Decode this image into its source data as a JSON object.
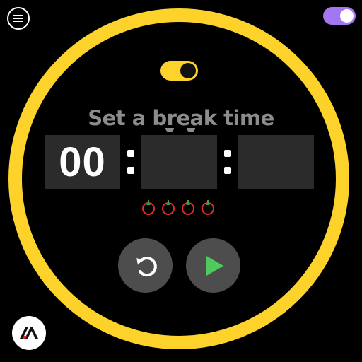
{
  "header": {
    "menu_icon": "hamburger-menu-icon",
    "theme_toggle": {
      "state": "on",
      "color": "#a277f0"
    }
  },
  "timer": {
    "mode_toggle": {
      "state": "on",
      "color": "#fdd22b"
    },
    "title": "Set a break time",
    "hours": "00",
    "minutes": "",
    "seconds": "",
    "separator": ":",
    "pomodoro_count": 4
  },
  "controls": {
    "reset_icon": "reset-icon",
    "play_icon": "play-icon"
  },
  "colors": {
    "ring": "#fdd22b",
    "background": "#000000",
    "digit_box": "#2b2b2b",
    "title": "#8c8c8c",
    "control_bg": "#4d4d4d",
    "play": "#4ecb5a",
    "tomato": "#e12c2c"
  }
}
